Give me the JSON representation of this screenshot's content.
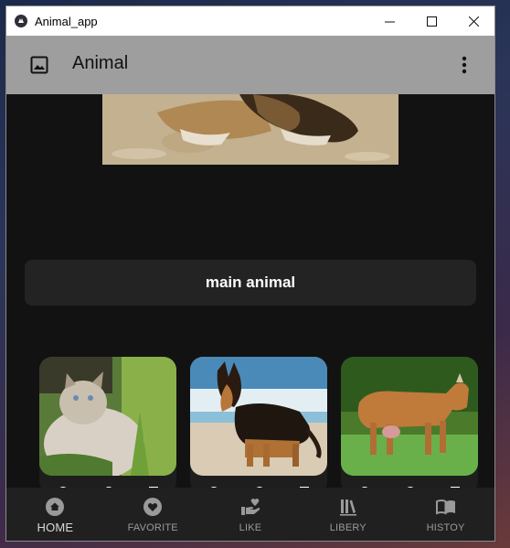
{
  "window": {
    "title": "Animal_app",
    "minimize": "—",
    "maximize": "☐",
    "close": "✕"
  },
  "appbar": {
    "title": "Animal"
  },
  "main": {
    "section_label": "main animal",
    "cards": [
      {
        "animal": "cat"
      },
      {
        "animal": "dog"
      },
      {
        "animal": "cow"
      }
    ]
  },
  "nav": {
    "items": [
      {
        "label": "HOME",
        "icon": "home-icon",
        "active": true
      },
      {
        "label": "FAVORITE",
        "icon": "heart-icon",
        "active": false
      },
      {
        "label": "LIKE",
        "icon": "hand-heart-icon",
        "active": false
      },
      {
        "label": "LIBERY",
        "icon": "books-icon",
        "active": false
      },
      {
        "label": "HISTOY",
        "icon": "book-open-icon",
        "active": false
      }
    ]
  },
  "colors": {
    "appbar": "#9e9e9e",
    "background": "#121212",
    "card": "#232323",
    "navbar": "#202020"
  }
}
